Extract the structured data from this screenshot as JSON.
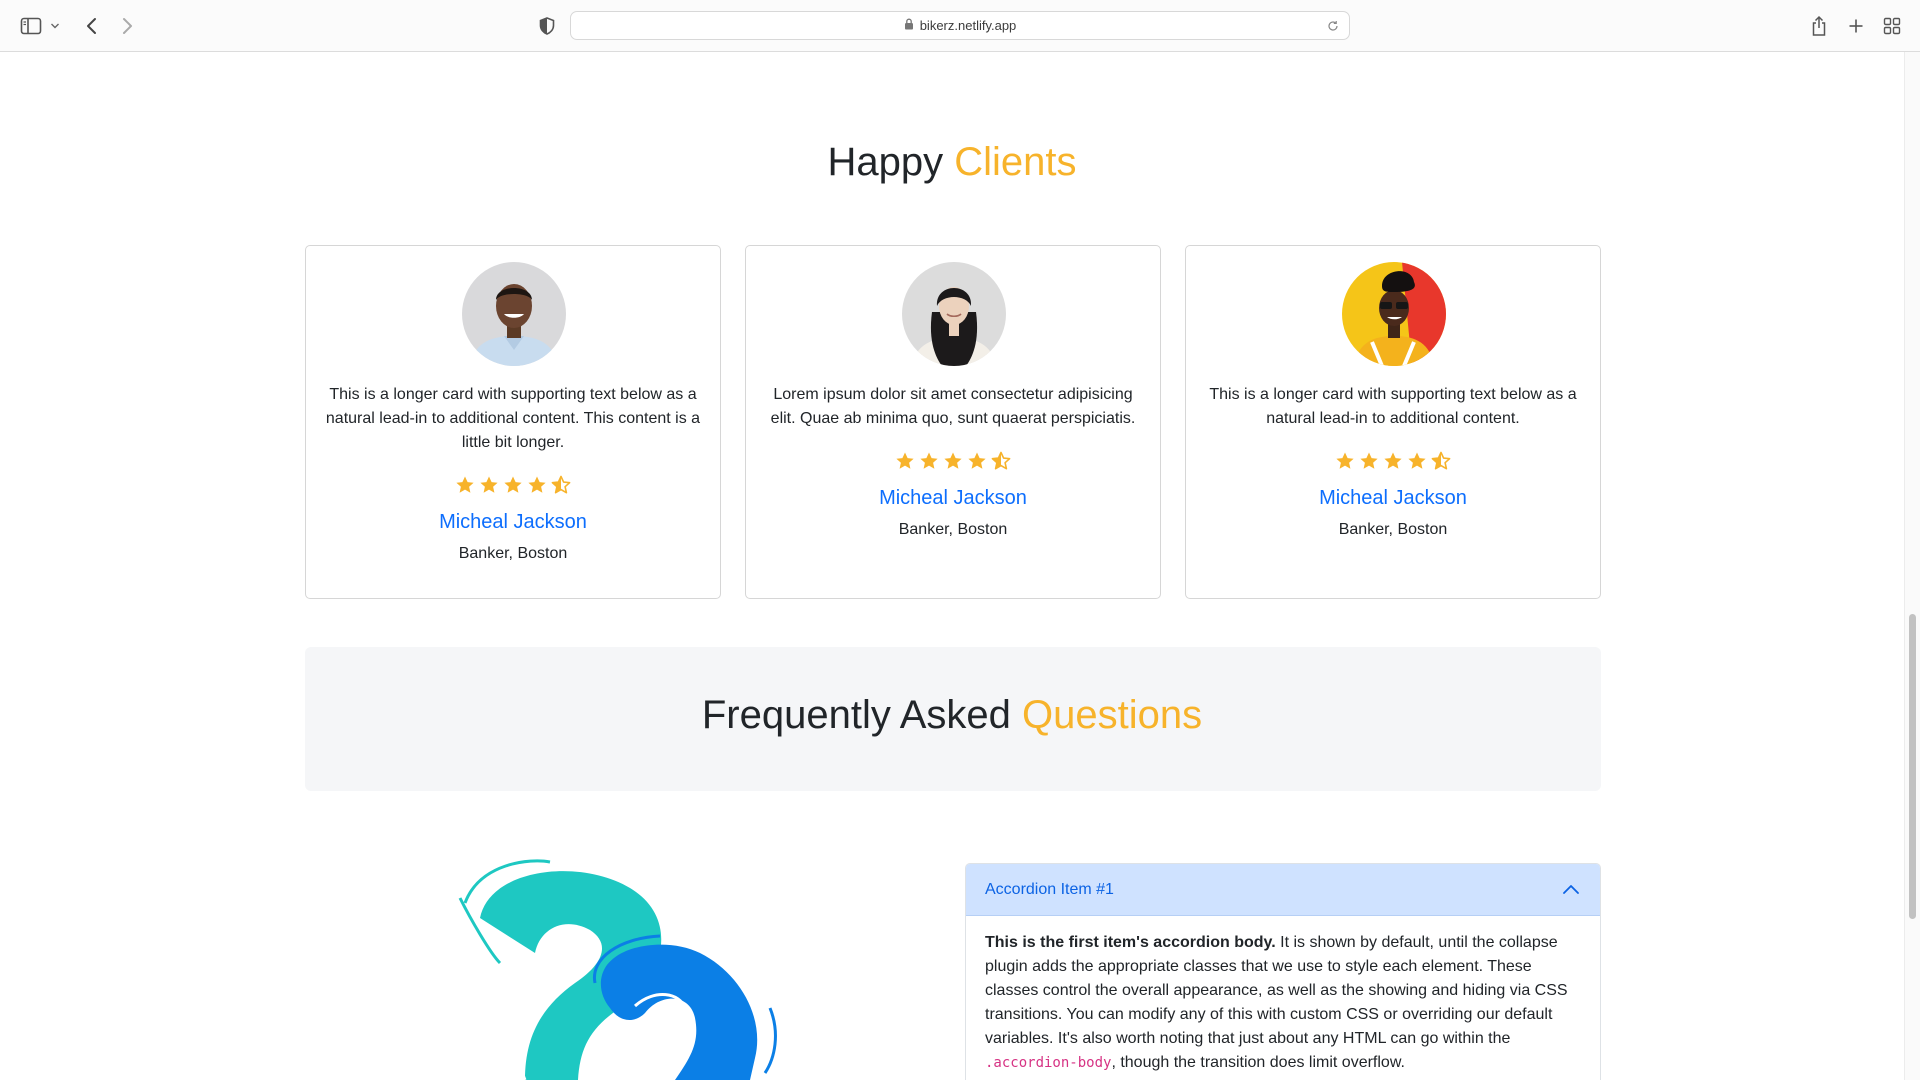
{
  "browser": {
    "url": "bikerz.netlify.app",
    "icons": [
      "sidebar-icon",
      "chevron-down-icon",
      "back-icon",
      "forward-icon",
      "shield-icon",
      "lock-icon",
      "reload-icon",
      "share-icon",
      "new-tab-icon",
      "tab-overview-icon"
    ]
  },
  "colors": {
    "accent": "#f7b32b",
    "link": "#0d6efd",
    "accordion_header_bg": "#cfe2ff",
    "accordion_header_text": "#0c63e4",
    "code": "#d63384"
  },
  "testimonials": {
    "title_main": "Happy",
    "title_accent": "Clients",
    "cards": [
      {
        "text": "This is a longer card with supporting text below as a natural lead-in to additional content. This content is a little bit longer.",
        "rating": 4.5,
        "name": "Micheal Jackson",
        "role": "Banker, Boston"
      },
      {
        "text": "Lorem ipsum dolor sit amet consectetur adipisicing elit. Quae ab minima quo, sunt quaerat perspiciatis.",
        "rating": 4.5,
        "name": "Micheal Jackson",
        "role": "Banker, Boston"
      },
      {
        "text": "This is a longer card with supporting text below as a natural lead-in to additional content.",
        "rating": 4.5,
        "name": "Micheal Jackson",
        "role": "Banker, Boston"
      }
    ]
  },
  "faq": {
    "title_main": "Frequently Asked",
    "title_accent": "Questions",
    "accordion": {
      "header": "Accordion Item #1",
      "body_strong": "This is the first item's accordion body.",
      "body_text": " It is shown by default, until the collapse plugin adds the appropriate classes that we use to style each element. These classes control the overall appearance, as well as the showing and hiding via CSS transitions. You can modify any of this with custom CSS or overriding our default variables. It's also worth noting that just about any HTML can go within the ",
      "body_code": ".accordion-body",
      "body_tail": ", though the transition does limit overflow."
    }
  }
}
